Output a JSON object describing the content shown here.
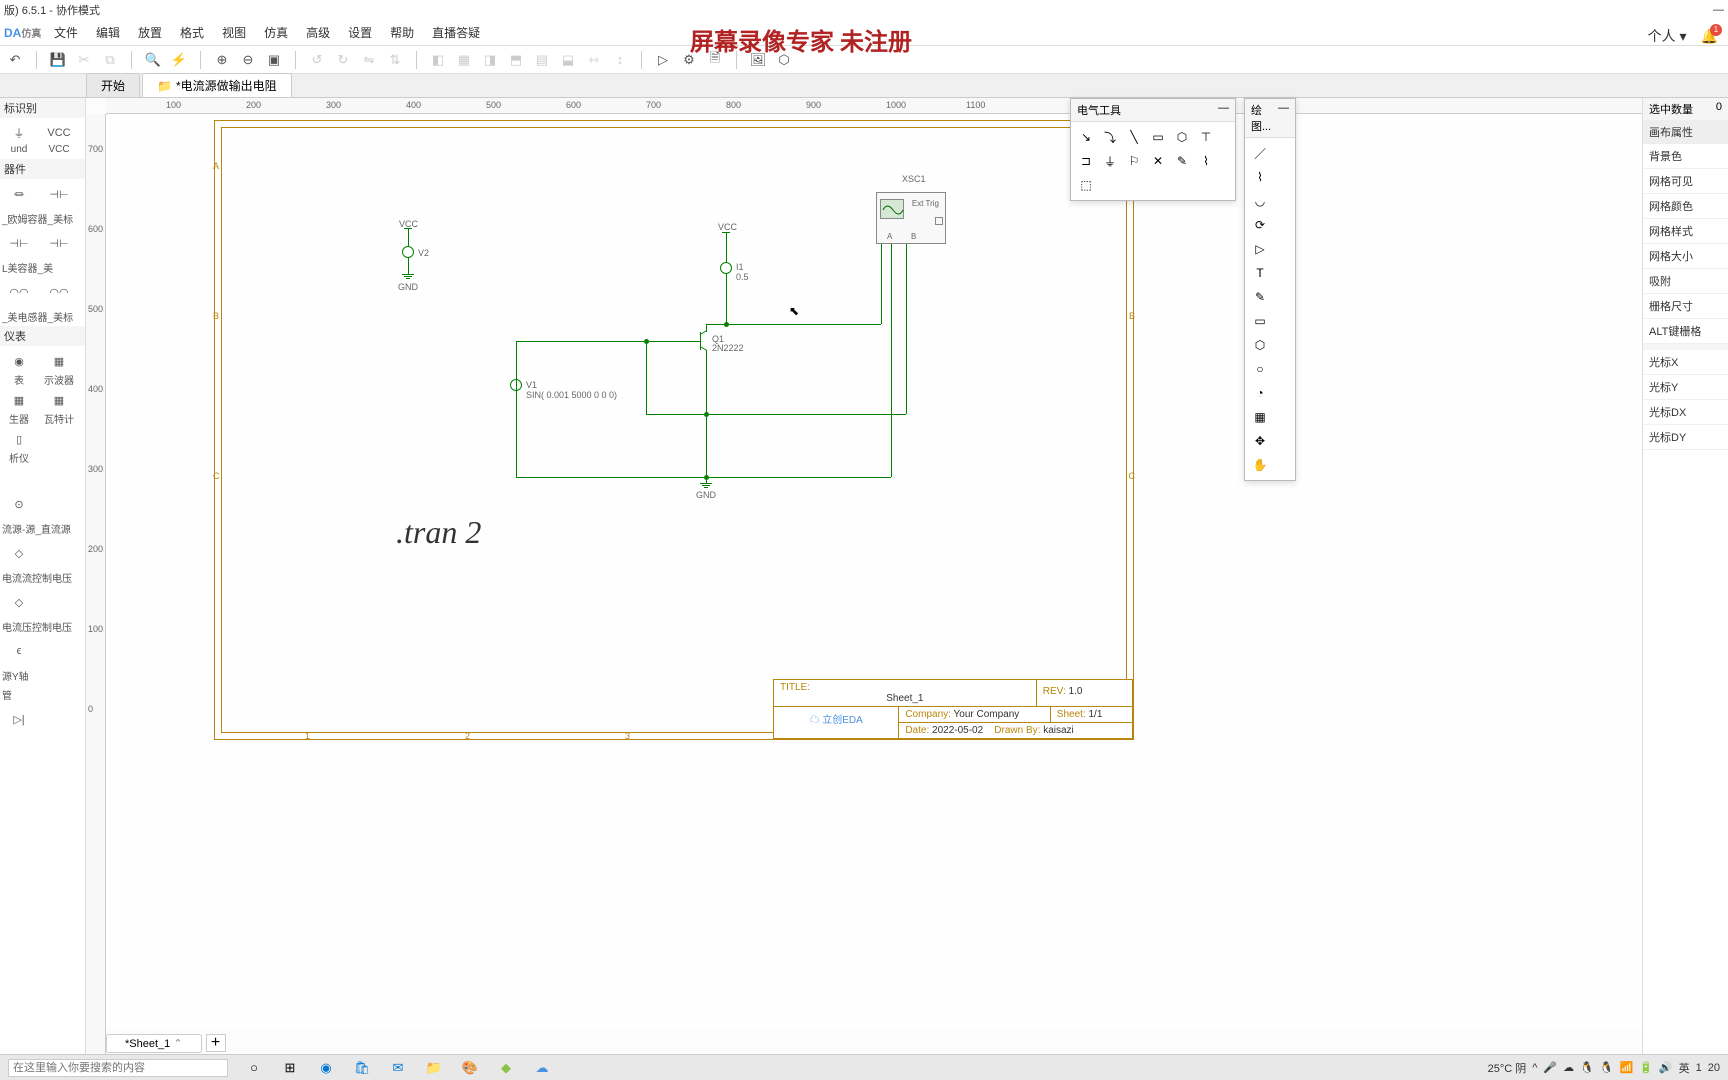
{
  "title": "版) 6.5.1 - 协作模式",
  "logo_text": "DA",
  "logo_sub": "仿真",
  "menus": [
    "文件",
    "编辑",
    "放置",
    "格式",
    "视图",
    "仿真",
    "高级",
    "设置",
    "帮助",
    "直播答疑"
  ],
  "watermark": "屏幕录像专家 未注册",
  "tabs": {
    "start": "开始",
    "file": "*电流源做输出电阻"
  },
  "ruler_h": [
    "100",
    "200",
    "300",
    "400",
    "500",
    "600",
    "700",
    "800",
    "900",
    "1000",
    "1100"
  ],
  "ruler_v": [
    "700",
    "600",
    "500",
    "400",
    "300",
    "200",
    "100",
    "0"
  ],
  "left": {
    "section1": "标识别",
    "items1": [
      {
        "label": "und"
      },
      {
        "label": "VCC",
        "sym": "VCC"
      }
    ],
    "section2": "器件",
    "labels2": [
      "_欧姆容器_美标",
      "L美容器_美",
      "_美电感器_美标"
    ],
    "section3": "仪表",
    "items3": [
      {
        "label": "表"
      },
      {
        "label": "示波器"
      },
      {
        "label": "生器"
      },
      {
        "label": "瓦特计"
      },
      {
        "label": "析仪"
      }
    ],
    "labels_bottom": [
      "流源-源_直流源",
      "电流流控制电压",
      "电流压控制电压",
      "源Y轴",
      "管"
    ]
  },
  "schematic": {
    "vcc1": "VCC",
    "v2": "V2",
    "gnd1": "GND",
    "vcc2": "VCC",
    "i1_ref": "I1",
    "i1_val": "0.5",
    "q1_ref": "Q1",
    "q1_val": "2N2222",
    "v1_ref": "V1",
    "v1_val": "SIN( 0.001 5000 0 0 0)",
    "gnd2": "GND",
    "xsc1": "XSC1",
    "ext_trig": "Ext Trig",
    "scope_a": "A",
    "scope_b": "B",
    "directive": ".tran 2"
  },
  "titleblock": {
    "title_label": "TITLE:",
    "title": "Sheet_1",
    "rev_label": "REV:",
    "rev": "1.0",
    "company_label": "Company:",
    "company": "Your Company",
    "sheet_label": "Sheet:",
    "sheet": "1/1",
    "date_label": "Date:",
    "date": "2022-05-02",
    "drawn_label": "Drawn By:",
    "drawn": "kaisazi",
    "eda_logo": "立创EDA"
  },
  "sheet_tab": "*Sheet_1",
  "float_elec": {
    "title": "电气工具"
  },
  "float_draw": {
    "title": "绘图..."
  },
  "right": {
    "sel_label": "选中数量",
    "sel_val": "0",
    "group1": "画布属性",
    "props": [
      "背景色",
      "网格可见",
      "网格颜色",
      "网格样式",
      "网格大小",
      "吸附",
      "栅格尺寸",
      "ALT键栅格"
    ],
    "cursor": [
      "光标X",
      "光标Y",
      "光标DX",
      "光标DY"
    ]
  },
  "user_label": "个人 ▾",
  "notif_count": "1",
  "taskbar": {
    "search_placeholder": "在这里输入你要搜索的内容",
    "weather": "25°C 阴",
    "ime": "英",
    "time": "1",
    "date": "20"
  }
}
